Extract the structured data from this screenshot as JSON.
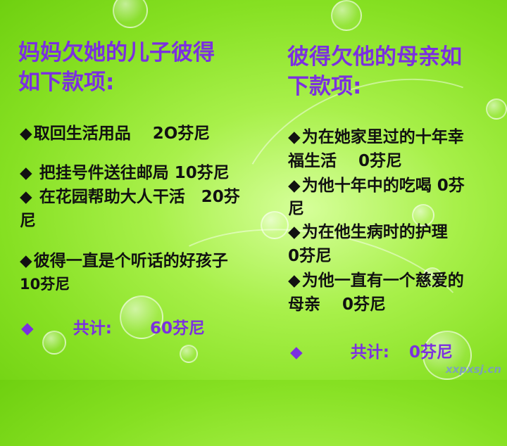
{
  "left": {
    "title_line1": "妈妈欠她的儿子彼得",
    "title_line2": "如下款项:",
    "items": [
      {
        "bullet": "◆",
        "line1": "取回生活用品　 2O芬尼"
      },
      {
        "bullet": "◆",
        "line1": " 把挂号件送往邮局  10芬尼"
      },
      {
        "bullet": "◆",
        "line1": " 在花园帮助大人干活　20芬",
        "line2": "尼"
      },
      {
        "bullet": "◆",
        "line1": "彼得一直是个听话的好孩子",
        "line2": "10芬尼"
      }
    ],
    "total": {
      "bullet": "◆",
      "label": "共计:",
      "value": "60芬尼"
    }
  },
  "right": {
    "title_line1": "彼得欠他的母亲如",
    "title_line2": "下款项:",
    "items": [
      {
        "bullet": "◆",
        "line1": "为在她家里过的十年幸",
        "line2": "福生活　 0芬尼"
      },
      {
        "bullet": "◆",
        "line1": "为他十年中的吃喝  0芬",
        "line2": "尼"
      },
      {
        "bullet": "◆",
        "line1": "为在他生病时的护理",
        "line2": "0芬尼"
      },
      {
        "bullet": "◆",
        "line1": "为他一直有一个慈爱的",
        "line2": "母亲　 0芬尼"
      }
    ],
    "total": {
      "bullet": "◆",
      "label": "共计:",
      "value": "0芬尼"
    }
  },
  "watermark": "xxpxsj.cn"
}
